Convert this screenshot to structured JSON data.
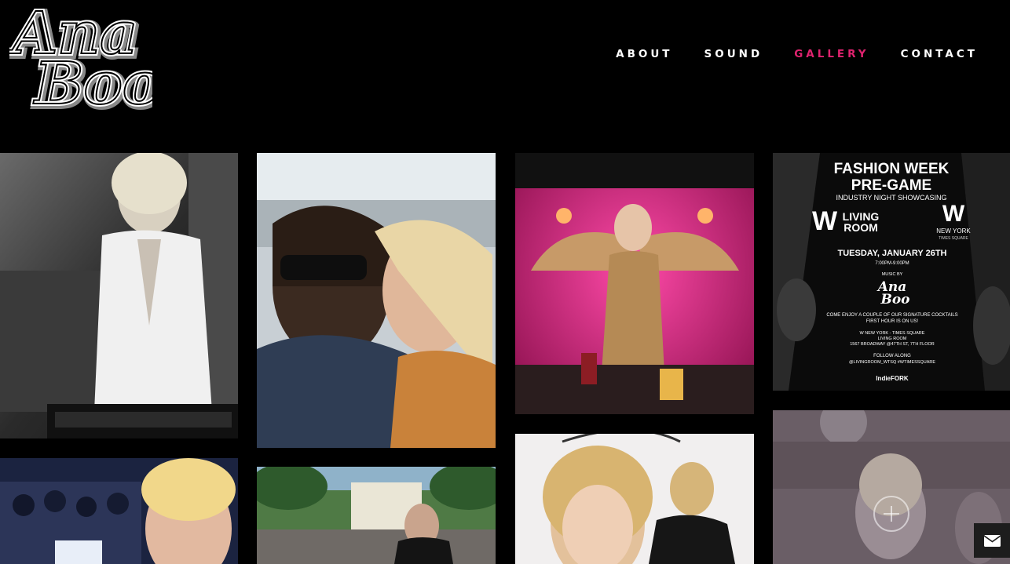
{
  "logo": {
    "text_line1": "Ana",
    "text_line2": "Boo"
  },
  "nav": {
    "items": [
      {
        "label": "ABOUT",
        "active": false
      },
      {
        "label": "SOUND",
        "active": false
      },
      {
        "label": "GALLERY",
        "active": true
      },
      {
        "label": "CONTACT",
        "active": false
      }
    ],
    "active_color": "#e0236f"
  },
  "flyer": {
    "title_line1": "FASHION WEEK",
    "title_line2": "PRE-GAME",
    "subtitle": "INDUSTRY NIGHT SHOWCASING",
    "venue_w": "W",
    "venue_name1": "LIVING",
    "venue_name2": "ROOM",
    "city": "NEW YORK",
    "city_sub": "TIMES SQUARE",
    "date": "TUESDAY, JANUARY 26TH",
    "time": "7:00PM-9:00PM",
    "music_by": "MUSIC BY",
    "offer_line1": "COME ENJOY A COUPLE OF OUR SIGNATURE COCKTAILS",
    "offer_line2": "FIRST HOUR IS ON US!",
    "address_line1": "W NEW YORK - TIMES SQUARE",
    "address_line2": "LIVING ROOM",
    "address_line3": "1567 BROADWAY @47TH ST, 7TH FLOOR",
    "follow": "FOLLOW ALONG",
    "handles": "@LIVINGROOM_WTSQ  #WTIMESSQUARE",
    "sponsor": "IndieFORK"
  },
  "icons": {
    "zoom": "plus-circle-icon",
    "mail": "envelope-icon"
  }
}
